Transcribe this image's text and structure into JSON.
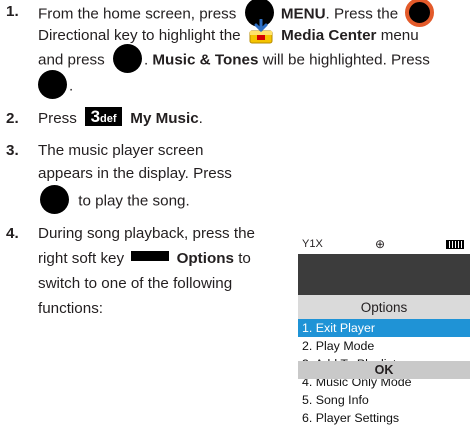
{
  "steps": {
    "s1": {
      "num": "1.",
      "l1a": "From the home screen, press",
      "l1b": "MENU",
      "l1c": ". Press the",
      "l2a": "Directional key to highlight the",
      "l2b": "Media Center",
      "l2c": "menu",
      "l3a": "and press",
      "l3b": ".",
      "l3c": "Music & Tones",
      "l3d": "will be highlighted. Press",
      "l4a": "."
    },
    "s2": {
      "num": "2.",
      "a": "Press",
      "key_digit": "3",
      "key_letters": "def",
      "b": "My Music",
      "c": "."
    },
    "s3": {
      "num": "3.",
      "l1": "The music player screen",
      "l2": "appears in the display. Press",
      "l3": "to play the song."
    },
    "s4": {
      "num": "4.",
      "l1": "During song playback, press the",
      "l2a": "right soft key",
      "l2b": "Options",
      "l2c": "to",
      "l3": "switch to one of the following",
      "l4": "functions:"
    }
  },
  "phone": {
    "signal": "Y1X",
    "title": "Options",
    "menu": [
      "1. Exit Player",
      "2. Play Mode",
      "3. Add To Playlist",
      "4. Music Only Mode",
      "5. Song Info",
      "6. Player Settings"
    ],
    "ok_label": "OK",
    "highlight_color": "#1f93d6"
  },
  "icons": {
    "ok_key": "ok-key-icon",
    "directional_key": "directional-key-icon",
    "media_center": "media-center-icon",
    "key_3def": "key-3def-icon",
    "right_soft_key": "right-soft-key-icon"
  }
}
